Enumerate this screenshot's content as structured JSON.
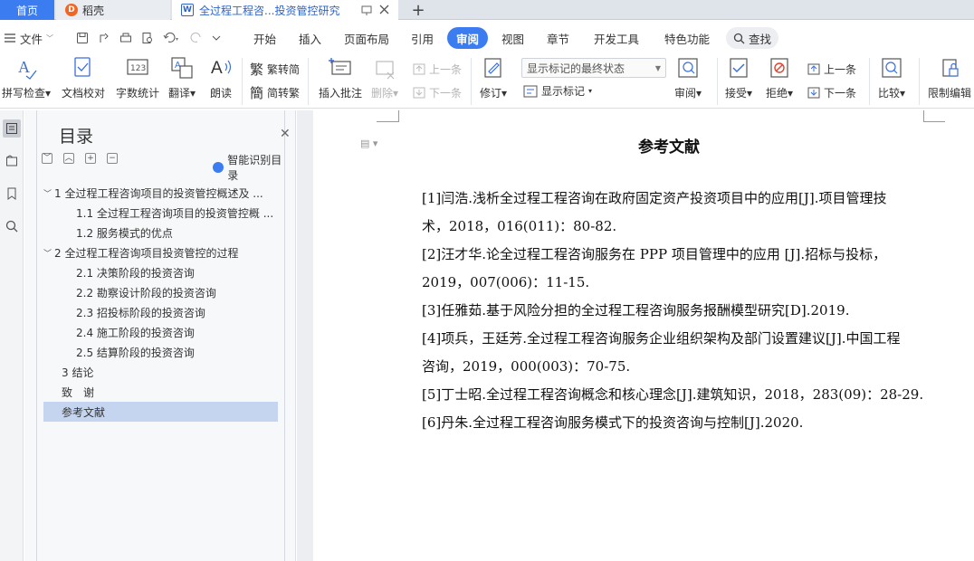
{
  "tabs": {
    "home": "首页",
    "daoke": "稻壳",
    "doc": "全过程工程咨...投资管控研究",
    "add": "+"
  },
  "menu": {
    "file": "文件",
    "items": [
      "开始",
      "插入",
      "页面布局",
      "引用",
      "审阅",
      "视图",
      "章节",
      "开发工具",
      "特色功能"
    ],
    "active": "审阅",
    "search": "查找"
  },
  "ribbon": {
    "spellcheck": "拼写检查",
    "doc_proof": "文档校对",
    "word_count": "字数统计",
    "translate": "翻译",
    "read_aloud": "朗读",
    "to_traditional": "繁转简",
    "to_simplified": "简转繁",
    "insert_comment": "插入批注",
    "delete": "删除",
    "prev_comment": "上一条",
    "next_comment": "下一条",
    "revise": "修订",
    "markup_state": "显示标记的最终状态",
    "show_markup": "显示标记",
    "review": "审阅",
    "accept": "接受",
    "reject": "拒绝",
    "prev_change": "上一条",
    "next_change": "下一条",
    "compare": "比较",
    "restrict_edit": "限制编辑"
  },
  "toc": {
    "title": "目录",
    "smart": "智能识别目录",
    "items": [
      "1 全过程工程咨询项目的投资管控概述及 ...",
      "1.1 全过程工程咨询项目的投资管控概 ...",
      "1.2 服务模式的优点",
      "2 全过程工程咨询项目投资管控的过程",
      "2.1 决策阶段的投资咨询",
      "2.2 勘察设计阶段的投资咨询",
      "2.3 招投标阶段的投资咨询",
      "2.4 施工阶段的投资咨询",
      "2.5 结算阶段的投资咨询",
      "3 结论",
      "致　谢",
      "参考文献"
    ]
  },
  "document": {
    "title": "参考文献",
    "lines": [
      "[1]闫浩.浅析全过程工程咨询在政府固定资产投资项目中的应用[J].项目管理技",
      "术，2018，016(011)：80-82.",
      "[2]汪才华.论全过程工程咨询服务在 PPP 项目管理中的应用 [J].招标与投标，",
      "2019，007(006)：11-15.",
      "[3]任雅茹.基于风险分担的全过程工程咨询服务报酬模型研究[D].2019.",
      "[4]项兵，王廷芳.全过程工程咨询服务企业组织架构及部门设置建议[J].中国工程",
      "咨询，2019，000(003)：70-75.",
      "[5]丁士昭.全过程工程咨询概念和核心理念[J].建筑知识，2018，283(09)：28-29.",
      "[6]丹朱.全过程工程咨询服务模式下的投资咨询与控制[J].2020."
    ]
  },
  "colors": {
    "accent": "#3b7cf0",
    "toc_selected": "#c5d5f0"
  }
}
